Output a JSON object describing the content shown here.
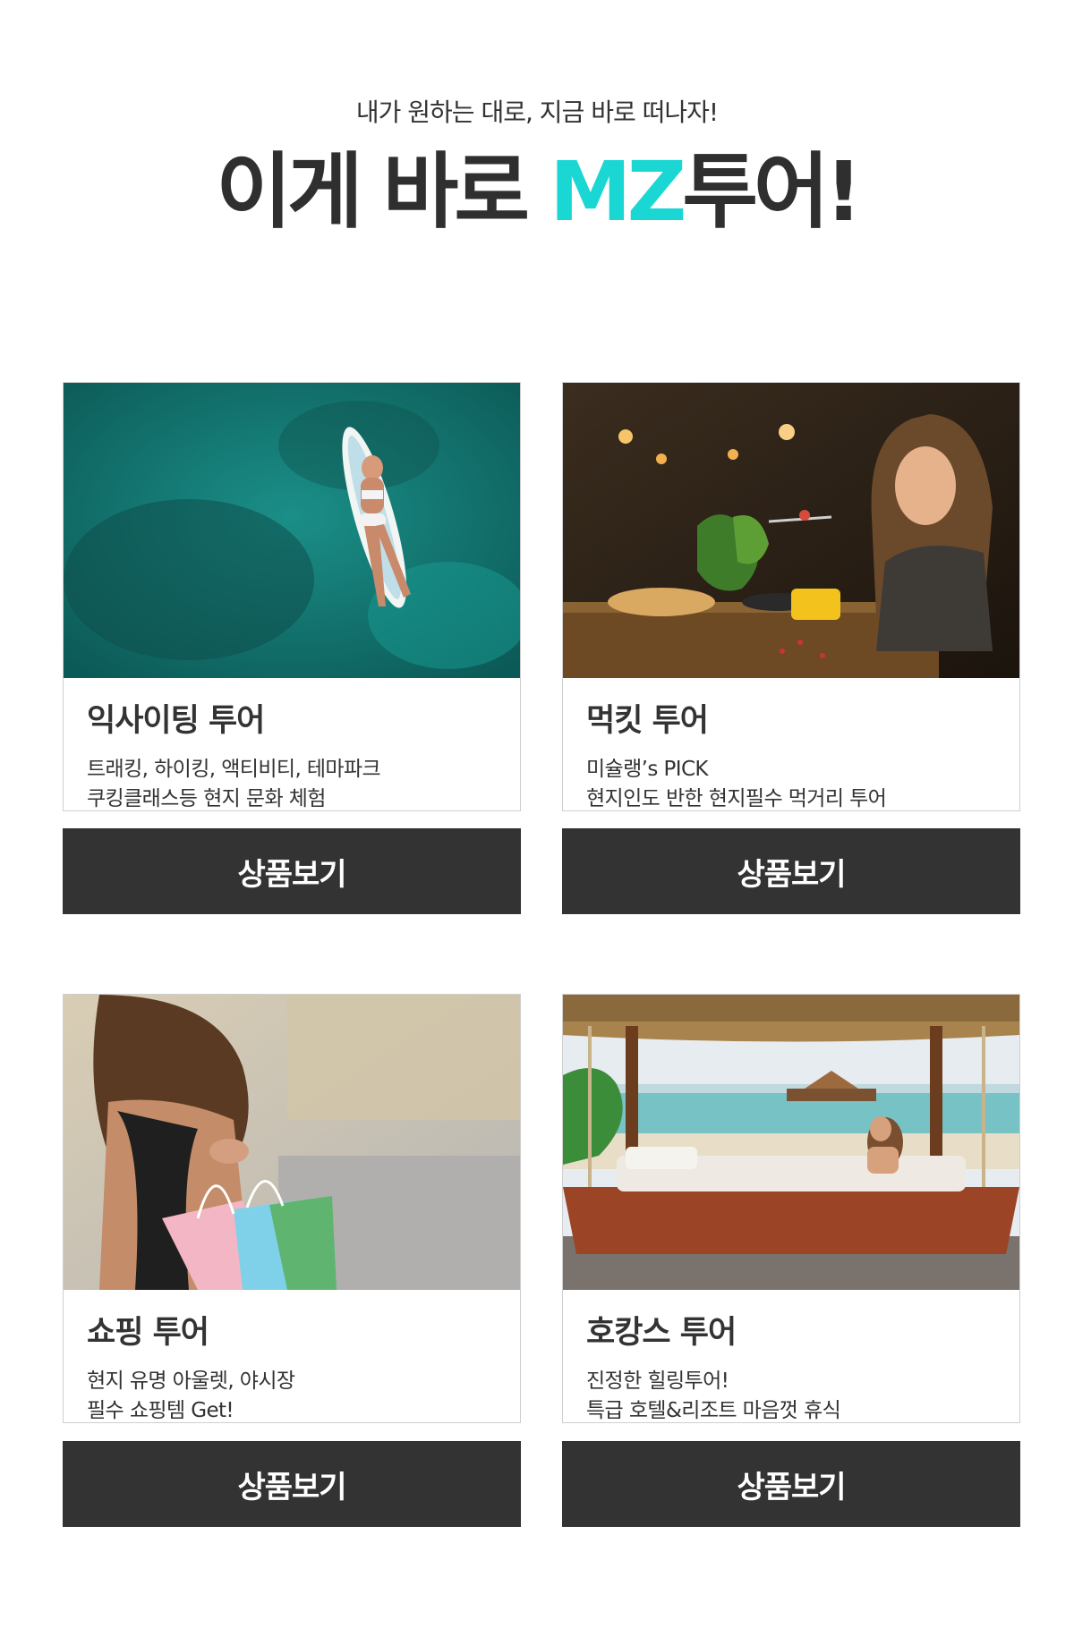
{
  "hero": {
    "subtitle": "내가 원하는 대로, 지금 바로 떠나자!",
    "headline_before": "이게 바로 ",
    "headline_accent": "MZ",
    "headline_after": "투어!"
  },
  "colors": {
    "accent": "#1ad7d4",
    "button_bg": "#333333",
    "text": "#333333"
  },
  "cards": [
    {
      "title": "익사이팅 투어",
      "desc_line1": "트래킹, 하이킹, 액티비티, 테마파크",
      "desc_line2": "쿠킹클래스등 현지 문화 체험",
      "button_label": "상품보기"
    },
    {
      "title": "먹킷 투어",
      "desc_line1": "미슐랭’s PICK",
      "desc_line2": "현지인도 반한 현지필수 먹거리 투어",
      "button_label": "상품보기"
    },
    {
      "title": "쇼핑 투어",
      "desc_line1": "현지 유명 아울렛, 야시장",
      "desc_line2": "필수 쇼핑템 Get!",
      "button_label": "상품보기"
    },
    {
      "title": "호캉스 투어",
      "desc_line1": "진정한 힐링투어!",
      "desc_line2": "특급 호텔&리조트 마음껏 휴식",
      "button_label": "상품보기"
    }
  ]
}
